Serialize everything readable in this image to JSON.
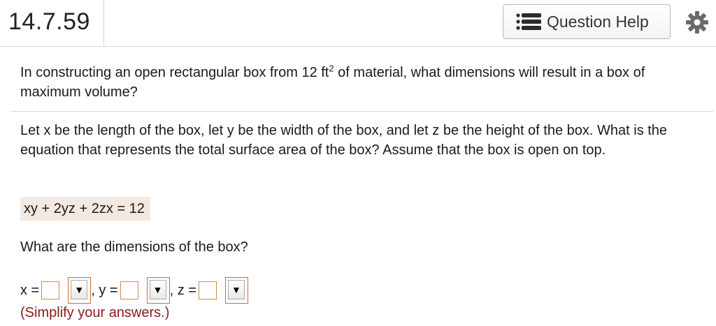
{
  "header": {
    "question_number": "14.7.59",
    "help_button_label": "Question Help",
    "help_icon": "list-icon",
    "settings_icon": "gear-icon"
  },
  "question": {
    "text_before_sup": "In constructing an open rectangular box from 12 ft",
    "superscript": "2",
    "text_after_sup": " of material, what dimensions will result in a box of maximum volume?"
  },
  "part1": {
    "prompt": "Let x be the length of the box, let y be the width of the box, and let z be the height of the box. What is the equation that represents the total surface area of the box? Assume that the box is open on top.",
    "answer": "xy + 2yz + 2zx = 12"
  },
  "part2": {
    "prompt": "What are the dimensions of the box?",
    "x_label": "x =",
    "y_label": ", y =",
    "z_label": ", z =",
    "x_value": "",
    "y_value": "",
    "z_value": "",
    "dropdown_glyph": "▼",
    "hint": "(Simplify your answers.)"
  },
  "colors": {
    "answer_bg": "#f4e9e1",
    "input_border": "#d08a4a",
    "hint_text": "#8b1a1a"
  }
}
